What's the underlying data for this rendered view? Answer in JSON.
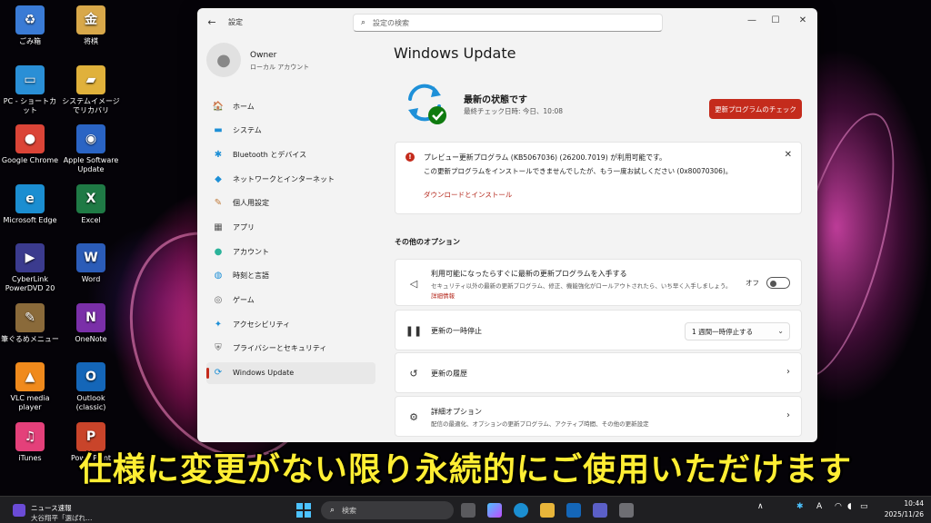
{
  "desktop": {
    "icons": [
      {
        "label": "ごみ箱",
        "glyph": "♻",
        "color": "#3a7bd5"
      },
      {
        "label": "将棋",
        "glyph": "金",
        "color": "#d8a84a"
      },
      {
        "label": "PC - ショートカット",
        "glyph": "▭",
        "color": "#2a8fd6"
      },
      {
        "label": "システムイメージでリカバリ",
        "glyph": "▰",
        "color": "#e0b13b"
      },
      {
        "label": "Google Chrome",
        "glyph": "●",
        "color": "#db4437"
      },
      {
        "label": "Apple Software Update",
        "glyph": "◉",
        "color": "#2a64c4"
      },
      {
        "label": "Microsoft Edge",
        "glyph": "e",
        "color": "#1b8ed1"
      },
      {
        "label": "Excel",
        "glyph": "X",
        "color": "#1f7a45"
      },
      {
        "label": "CyberLink PowerDVD 20",
        "glyph": "▶",
        "color": "#3b3b8e"
      },
      {
        "label": "Word",
        "glyph": "W",
        "color": "#2b5cb8"
      },
      {
        "label": "筆ぐるめメニュー",
        "glyph": "✎",
        "color": "#8a6a3a"
      },
      {
        "label": "OneNote",
        "glyph": "N",
        "color": "#7a2fa8"
      },
      {
        "label": "VLC media player",
        "glyph": "▲",
        "color": "#f08a1c"
      },
      {
        "label": "Outlook (classic)",
        "glyph": "O",
        "color": "#1466b8"
      },
      {
        "label": "iTunes",
        "glyph": "♫",
        "color": "#e4407a"
      },
      {
        "label": "PowerPoint",
        "glyph": "P",
        "color": "#c9442a"
      }
    ]
  },
  "window": {
    "app_title": "設定",
    "search_placeholder": "設定の検索",
    "controls": {
      "minimize": "—",
      "maximize": "☐",
      "close": "✕"
    }
  },
  "profile": {
    "name": "Owner",
    "account_type": "ローカル アカウント"
  },
  "sidebar": {
    "items": [
      {
        "label": "ホーム",
        "icon": "🏠",
        "color": "#555"
      },
      {
        "label": "システム",
        "icon": "▬",
        "color": "#1d8fd6"
      },
      {
        "label": "Bluetooth とデバイス",
        "icon": "✱",
        "color": "#1d8fd6"
      },
      {
        "label": "ネットワークとインターネット",
        "icon": "◆",
        "color": "#1d8fd6"
      },
      {
        "label": "個人用設定",
        "icon": "✎",
        "color": "#c07a3a"
      },
      {
        "label": "アプリ",
        "icon": "▦",
        "color": "#555"
      },
      {
        "label": "アカウント",
        "icon": "●",
        "color": "#2bb39a"
      },
      {
        "label": "時刻と言語",
        "icon": "◍",
        "color": "#1d8fd6"
      },
      {
        "label": "ゲーム",
        "icon": "◎",
        "color": "#666"
      },
      {
        "label": "アクセシビリティ",
        "icon": "✦",
        "color": "#1d8fd6"
      },
      {
        "label": "プライバシーとセキュリティ",
        "icon": "⛨",
        "color": "#666"
      },
      {
        "label": "Windows Update",
        "icon": "⟳",
        "color": "#1d8fd6"
      }
    ]
  },
  "main": {
    "title": "Windows Update",
    "status_title": "最新の状態です",
    "status_sub": "最終チェック日時: 今日、10:08",
    "check_button": "更新プログラムのチェック",
    "alert": {
      "title": "プレビュー更新プログラム (KB5067036) (26200.7019) が利用可能です。",
      "message": "この更新プログラムをインストールできませんでしたが、もう一度お試しください (0x80070306)。",
      "link": "ダウンロードとインストール"
    },
    "section_label": "その他のオプション",
    "options": [
      {
        "title": "利用可能になったらすぐに最新の更新プログラムを入手する",
        "subtitle": "セキュリティ以外の最新の更新プログラム、修正、機能強化がロールアウトされたら、いち早く入手しましょう。",
        "link": "詳細情報",
        "toggle_label": "オフ"
      },
      {
        "title": "更新の一時停止",
        "dropdown": "1 週間一時停止する"
      },
      {
        "title": "更新の履歴"
      },
      {
        "title": "詳細オプション",
        "subtitle": "配信の最適化、オプションの更新プログラム、アクティブ時間、その他の更新設定"
      }
    ]
  },
  "caption": "仕様に変更がない限り永続的にご使用いただけます",
  "taskbar": {
    "news_title": "ニュース速報",
    "news_sub": "大谷翔平「選ばれ…",
    "search_label": "検索",
    "time": "10:44",
    "date": "2025/11/26",
    "ime": "A"
  }
}
